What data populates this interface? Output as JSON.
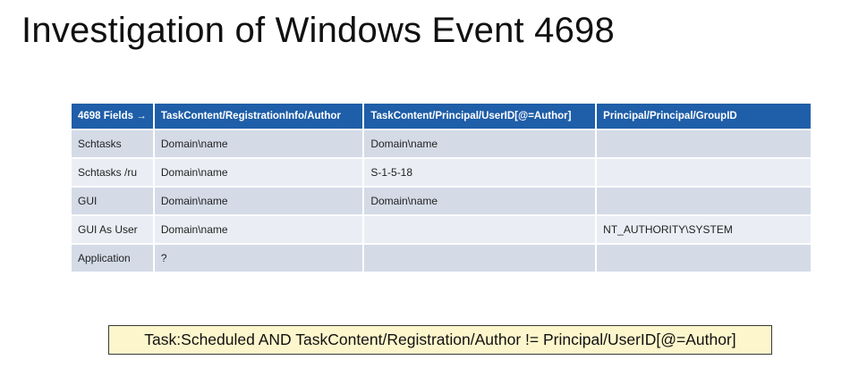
{
  "slide": {
    "title": "Investigation of Windows Event 4698"
  },
  "table": {
    "headers": [
      "4698 Fields →",
      "TaskContent/RegistrationInfo/Author",
      "TaskContent/Principal/UserID[@=Author]",
      "Principal/Principal/GroupID"
    ],
    "rows": [
      [
        "Schtasks",
        "Domain\\name",
        "Domain\\name",
        ""
      ],
      [
        "Schtasks /ru",
        "Domain\\name",
        "S-1-5-18",
        ""
      ],
      [
        "GUI",
        "Domain\\name",
        "Domain\\name",
        ""
      ],
      [
        "GUI As User",
        "Domain\\name",
        "",
        "NT_AUTHORITY\\SYSTEM"
      ],
      [
        "Application",
        "?",
        "",
        ""
      ]
    ]
  },
  "query": {
    "text": "Task:Scheduled AND TaskContent/Registration/Author != Principal/UserID[@=Author]"
  },
  "colors": {
    "header_bg": "#1f5ea8",
    "row_odd_bg": "#d4dbe7",
    "row_even_bg": "#eaeef4",
    "query_bg": "#fdf6cc"
  }
}
